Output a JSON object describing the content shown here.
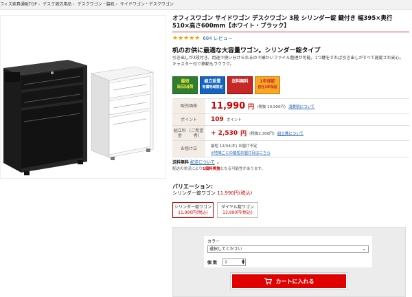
{
  "breadcrumb": [
    "フィス家具通販TOP",
    "デスク周辺用品",
    "デスクワゴン・脇机",
    "サイドワゴン・デスクワゴン"
  ],
  "product": {
    "title": "オフィスワゴン サイドワゴン デスクワゴン 3段 シリンダー錠 鍵付き 幅395×奥行510×高さ600mm【ホワイト・ブラック】",
    "rating_stars": "★★★★★",
    "rating_value": 4.5,
    "review_link": "684 レビュー",
    "catch": "机のお供に最適な大容量ワゴン。シリンダー錠タイプ",
    "description": "引き出しが3段付き。用途で使い分けられるので細かいファイル整理が可能。1つ鍵をすれば引き出しがすべて施錠され安心。キャスター付で移動もラクラク。"
  },
  "badges": [
    {
      "line1": "最短",
      "line2": "当日出荷"
    },
    {
      "line1": "組立設置",
      "line2": "有償地域限定"
    },
    {
      "line1": "送料無料",
      "line2": ""
    },
    {
      "line1": "1年保証",
      "line2": "自社1年保証"
    }
  ],
  "pricing": {
    "price_label": "販売価格",
    "price_value": "11,990",
    "price_unit": "円",
    "price_tax_note": "(税抜 10,900円)",
    "price_link": "消費税について",
    "points_label": "ポイント",
    "points_value": "109",
    "points_unit": "ポイント",
    "assembly_label": "組立料金",
    "assembly_sub": "(ご希望者)",
    "assembly_value": "+ 2,530",
    "assembly_unit": "円",
    "assembly_tax_note": "(税抜2,300円)",
    "assembly_link": "組立費について",
    "delivery_label": "お届け日",
    "delivery_value": "最短 12/04(木) お届け予定",
    "delivery_link": "※地域ごとの最短お届け日はこちら"
  },
  "shipping": {
    "label": "送料無料",
    "link": "配送について",
    "note_prefix": "配送の状況により",
    "note_bold": "1個料実施",
    "note_suffix": "となる可能性があります。"
  },
  "variation": {
    "title": "バリエーション:",
    "selected_name": "シリンダー錠ワゴン",
    "selected_price": "11,990円(税込)",
    "options": [
      {
        "name": "シリンダー錠ワゴン",
        "price": "11,990円(税込)"
      },
      {
        "name": "ダイヤル錠ワゴン",
        "price": "13,990円(税込)"
      }
    ]
  },
  "cart": {
    "color_label": "カラー",
    "color_select_value": "選択してください",
    "qty_label": "個 数",
    "qty_value": "1",
    "button_label": "カートに入れる"
  },
  "colors": {
    "accent_red": "#e00000",
    "link_blue": "#1a5fb4",
    "star": "#f5a000"
  }
}
